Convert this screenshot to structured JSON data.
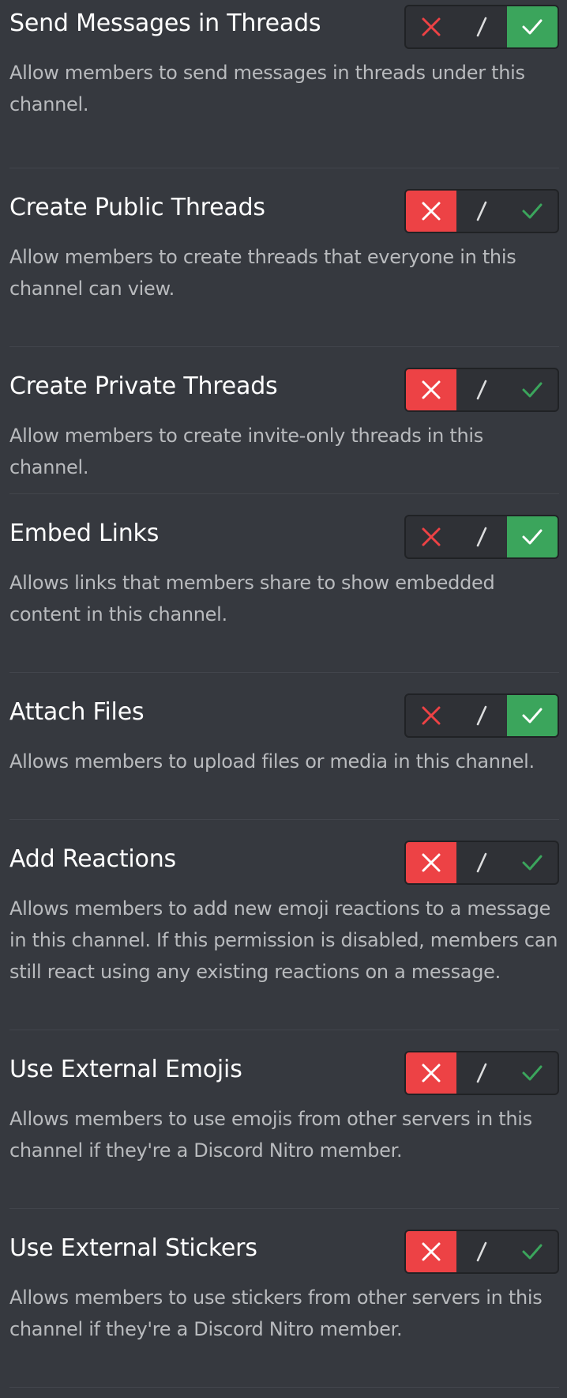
{
  "permissions": [
    {
      "title": "Send Messages in Threads",
      "description": "Allow members to send messages in threads under this channel.",
      "state": "allow"
    },
    {
      "title": "Create Public Threads",
      "description": "Allow members to create threads that everyone in this channel can view.",
      "state": "deny"
    },
    {
      "title": "Create Private Threads",
      "description": "Allow members to create invite-only threads in this channel.",
      "state": "deny"
    },
    {
      "title": "Embed Links",
      "description": "Allows links that members share to show embedded content in this channel.",
      "state": "allow"
    },
    {
      "title": "Attach Files",
      "description": "Allows members to upload files or media in this channel.",
      "state": "allow"
    },
    {
      "title": "Add Reactions",
      "description": "Allows members to add new emoji reactions to a message in this channel. If this permission is disabled, members can still react using any existing reactions on a message.",
      "state": "deny"
    },
    {
      "title": "Use External Emojis",
      "description": "Allows members to use emojis from other servers in this channel if they're a Discord Nitro member.",
      "state": "deny"
    },
    {
      "title": "Use External Stickers",
      "description": "Allows members to use stickers from other servers in this channel if they're a Discord Nitro member.",
      "state": "deny"
    }
  ],
  "icons": {
    "deny": "x-icon",
    "neutral": "slash-icon",
    "allow": "check-icon"
  },
  "colors": {
    "background": "#36393f",
    "deny": "#ed4245",
    "allow": "#3ba55c",
    "description": "#b9bbbe"
  }
}
